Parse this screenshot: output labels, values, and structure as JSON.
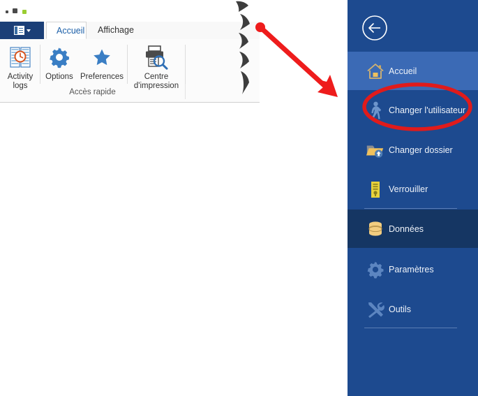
{
  "window": {
    "dots": [
      "dot-dark-small",
      "dot-dark-large",
      "dot-green"
    ]
  },
  "ribbon": {
    "app_menu": {
      "name": "app-menu-button",
      "icon": "panel-layout-icon",
      "caret": "chevron-down-icon"
    },
    "tabs": [
      {
        "label": "Accueil",
        "active": true
      },
      {
        "label": "Affichage",
        "active": false
      }
    ],
    "buttons": [
      {
        "label_line1": "Activity",
        "label_line2": "logs",
        "icon": "activity-logs-icon"
      },
      {
        "label_line1": "Options",
        "label_line2": "",
        "icon": "gear-icon"
      },
      {
        "label_line1": "Preferences",
        "label_line2": "",
        "icon": "star-icon"
      },
      {
        "label_line1": "Centre",
        "label_line2": "d'impression",
        "icon": "print-center-icon"
      }
    ],
    "group_label": "Accès rapide"
  },
  "backstage": {
    "back_button": {
      "name": "back-button",
      "icon": "arrow-left-circle-icon"
    },
    "items": [
      {
        "label": "Accueil",
        "icon": "home-icon",
        "state": "selected"
      },
      {
        "label": "Changer l'utilisateur",
        "icon": "walking-person-icon",
        "state": "normal"
      },
      {
        "label": "Changer dossier",
        "icon": "folder-upload-icon",
        "state": "normal"
      },
      {
        "label": "Verrouiller",
        "icon": "lock-icon",
        "state": "normal"
      },
      {
        "label": "Données",
        "icon": "database-icon",
        "state": "pressed"
      },
      {
        "label": "Paramètres",
        "icon": "gear-icon",
        "state": "normal"
      },
      {
        "label": "Outils",
        "icon": "tools-icon",
        "state": "normal"
      }
    ]
  },
  "annotations": {
    "arrow": {
      "name": "red-pointer-arrow",
      "color": "#ee1c1c"
    },
    "ellipse": {
      "name": "red-highlight-ellipse",
      "color": "#e01b1b",
      "targets": "Changer l'utilisateur"
    },
    "torn_edge": {
      "name": "torn-paper-edge",
      "color": "#3d3d3d"
    }
  },
  "colors": {
    "panel_blue": "#1d4a8f",
    "panel_selected_blue": "#3b6ab5",
    "panel_pressed_blue": "#153663",
    "app_menu_blue": "#1b3f77",
    "ribbon_icon_blue": "#3a7ec4",
    "accent_red": "#e01b1b",
    "lock_yellow": "#e8d23c",
    "database_gold": "#f2cd80"
  }
}
